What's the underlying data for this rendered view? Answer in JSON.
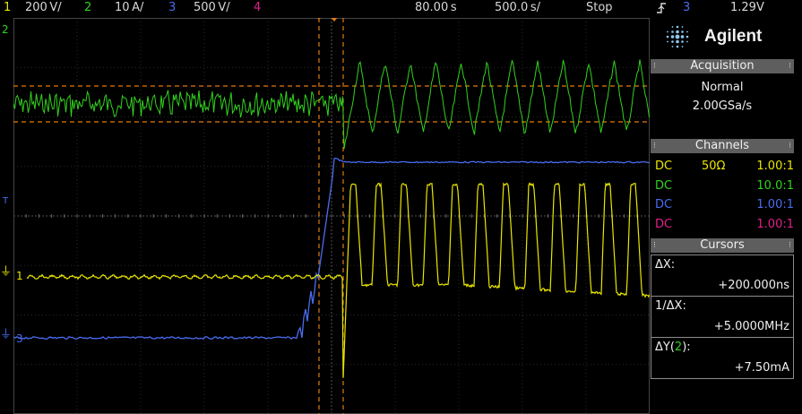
{
  "topbar": {
    "ch1_num": "1",
    "ch1_scale": "200 V/",
    "ch2_num": "2",
    "ch2_scale": "10 A/",
    "ch3_num": "3",
    "ch3_scale": "500 V/",
    "ch4_num": "4",
    "time_delay": "80.00 s",
    "time_scale": "500.0 s/",
    "run_state": "Stop",
    "trigger_icon": "trigger-edge-icon",
    "trigger_channel": "3",
    "trigger_level": "1.29V"
  },
  "scope": {
    "ch1_marker": "1",
    "ch2_marker": "2",
    "ch3_marker": "3",
    "trigger_marker": "T",
    "colors": {
      "ch1": "#e9e600",
      "ch2": "#32d21e",
      "ch3": "#4a6cf0",
      "ch4": "#e0208a",
      "cursor": "#e07a10"
    }
  },
  "panel": {
    "brand": "Agilent",
    "acquisition": {
      "header": "Acquisition",
      "mode": "Normal",
      "rate": "2.00GSa/s"
    },
    "channels": {
      "header": "Channels",
      "rows": [
        {
          "coupling": "DC",
          "impedance": "50Ω",
          "probe": "1.00:1"
        },
        {
          "coupling": "DC",
          "impedance": "",
          "probe": "10.0:1"
        },
        {
          "coupling": "DC",
          "impedance": "",
          "probe": "1.00:1"
        },
        {
          "coupling": "DC",
          "impedance": "",
          "probe": "1.00:1"
        }
      ]
    },
    "cursors": {
      "header": "Cursors",
      "dx_label": "ΔX:",
      "dx_value": "+200.000ns",
      "inv_dx_label": "1/ΔX:",
      "inv_dx_value": "+5.0000MHz",
      "dy_label_pre": "ΔY(",
      "dy_channel": "2",
      "dy_label_post": "):",
      "dy_value": "+7.50mA"
    }
  }
}
